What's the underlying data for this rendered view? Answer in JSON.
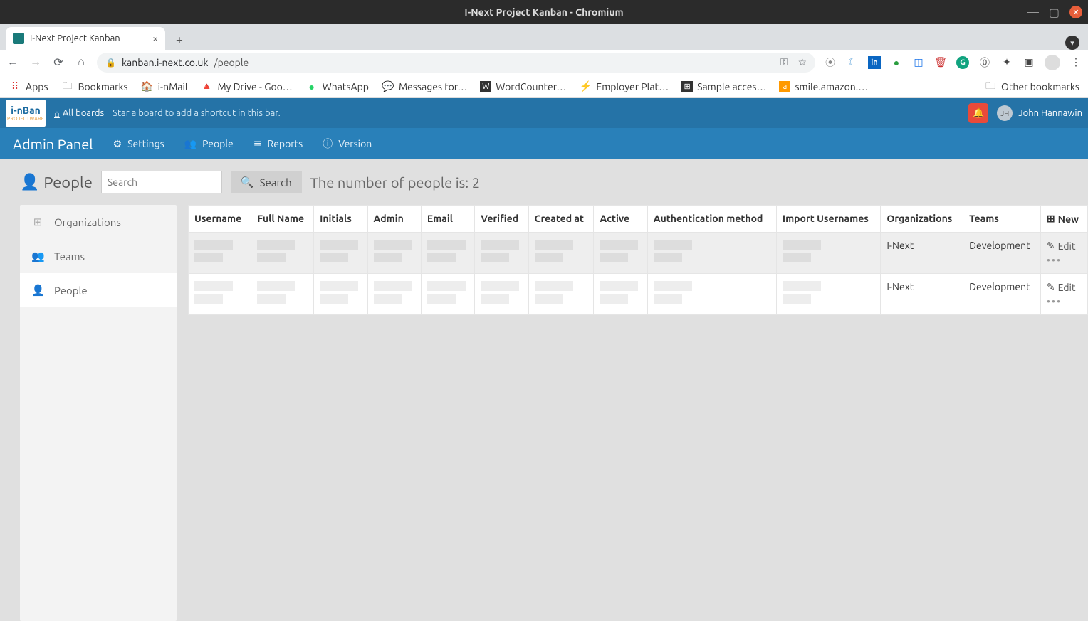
{
  "os": {
    "title": "I-Next Project Kanban - Chromium"
  },
  "tab": {
    "title": "I-Next Project Kanban"
  },
  "url": {
    "host": "kanban.i-next.co.uk",
    "path": "/people"
  },
  "bookmarks": {
    "apps": "Apps",
    "items": [
      "Bookmarks",
      "i-nMail",
      "My Drive - Goo…",
      "WhatsApp",
      "Messages for…",
      "WordCounter…",
      "Employer Plat…",
      "Sample acces…",
      "smile.amazon.…"
    ],
    "other": "Other bookmarks"
  },
  "appbar": {
    "logo_top": "i-nBan",
    "logo_sub": "PROJECTWARE",
    "all_boards": "All boards",
    "star_hint": "Star a board to add a shortcut in this bar.",
    "user_initials": "JH",
    "user_name": "John Hannawin"
  },
  "adminnav": {
    "title": "Admin Panel",
    "settings": "Settings",
    "people": "People",
    "reports": "Reports",
    "version": "Version"
  },
  "page": {
    "title": "People",
    "search_placeholder": "Search",
    "search_btn": "Search",
    "count_label": "The number of people is: 2"
  },
  "sidebar": {
    "items": [
      {
        "label": "Organizations"
      },
      {
        "label": "Teams"
      },
      {
        "label": "People"
      }
    ]
  },
  "table": {
    "headers": [
      "Username",
      "Full Name",
      "Initials",
      "Admin",
      "Email",
      "Verified",
      "Created at",
      "Active",
      "Authentication method",
      "Import Usernames",
      "Organizations",
      "Teams"
    ],
    "new_label": "New",
    "edit_label": "Edit",
    "rows": [
      {
        "org": "I-Next",
        "team": "Development"
      },
      {
        "org": "I-Next",
        "team": "Development"
      }
    ]
  }
}
